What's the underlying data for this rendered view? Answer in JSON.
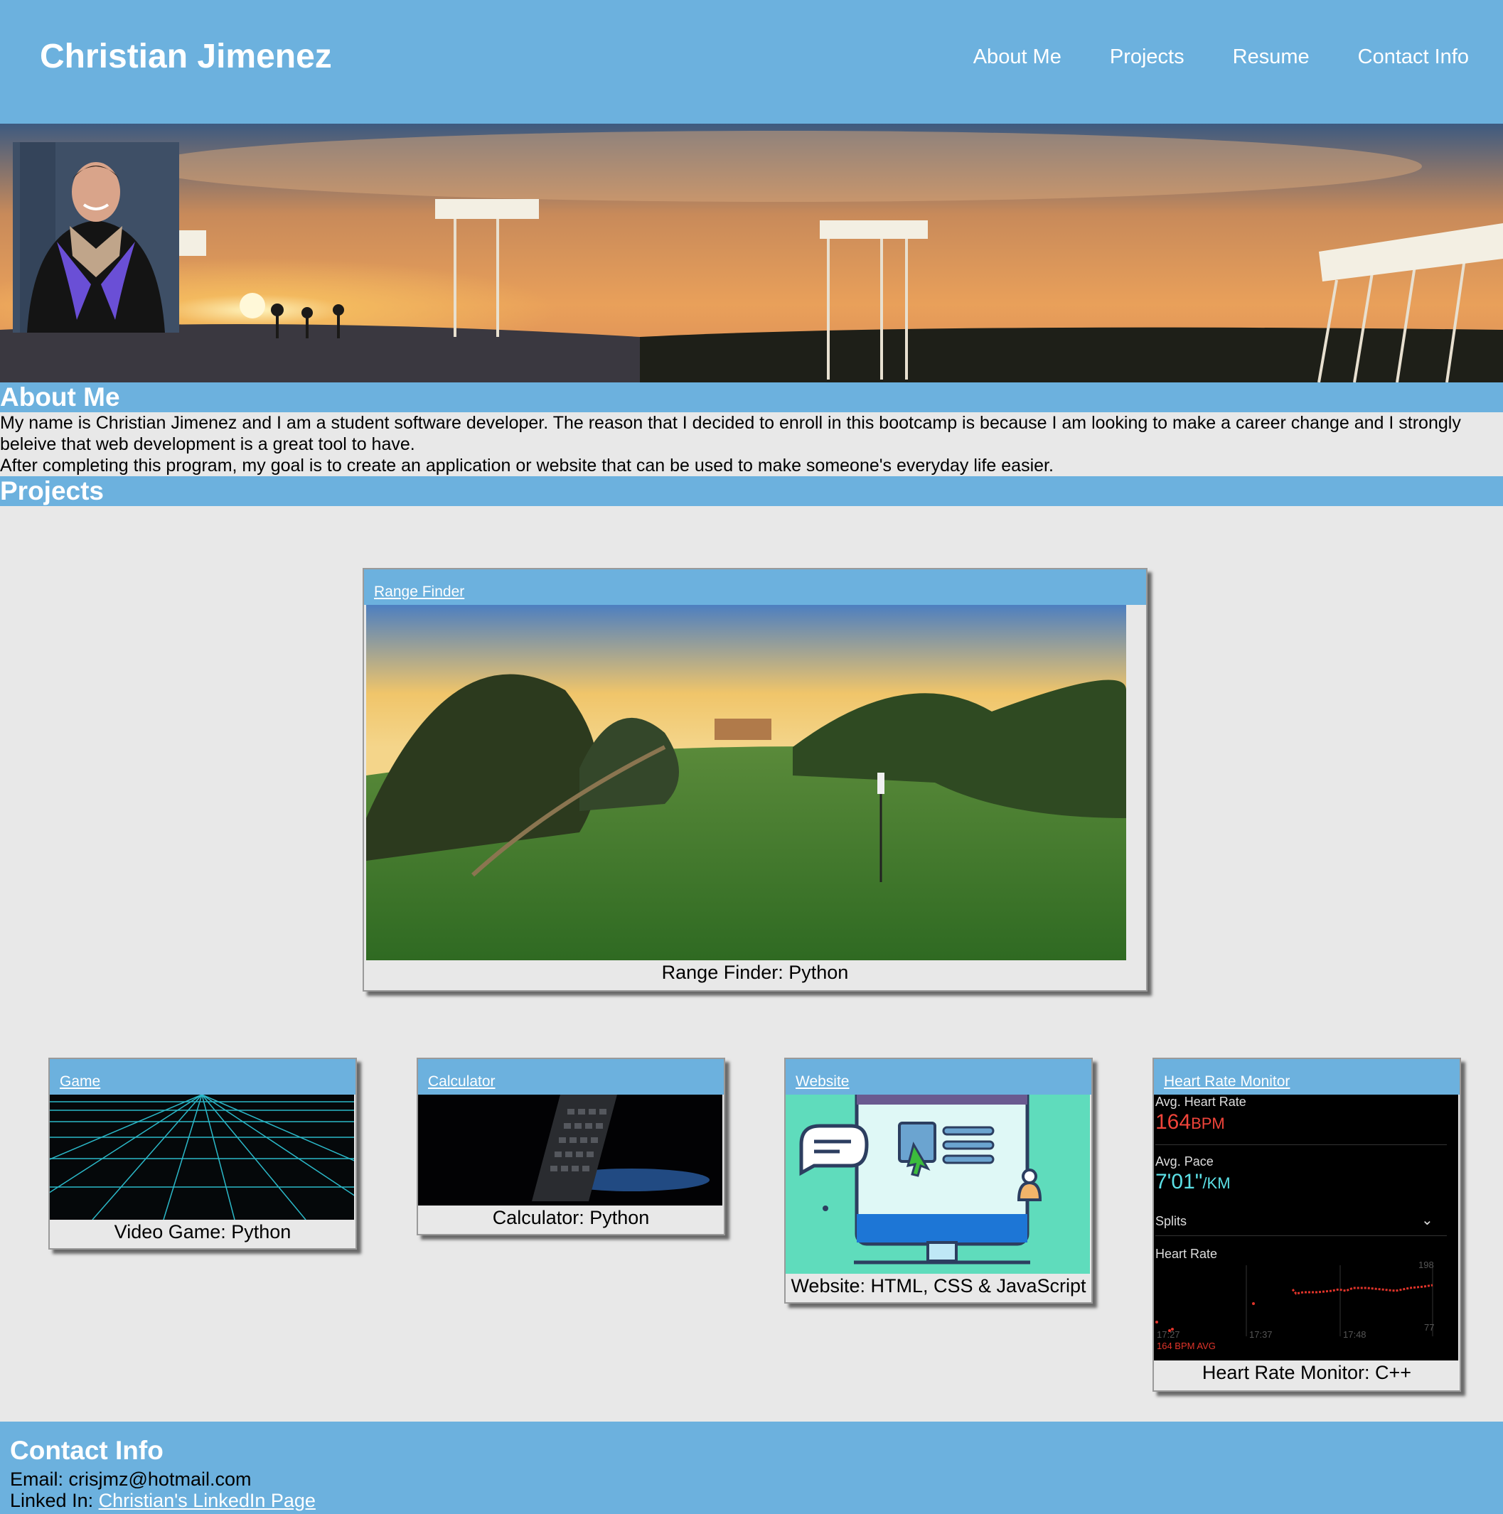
{
  "header": {
    "title": "Christian Jimenez",
    "nav": [
      "About Me",
      "Projects",
      "Resume",
      "Contact Info"
    ]
  },
  "about": {
    "heading": "About Me",
    "paragraph1": "My name is Christian Jimenez and I am a student software developer. The reason that I decided to enroll in this bootcamp is because I am looking to make a career change and I strongly beleive that web development is a great tool to have.",
    "paragraph2": "After completing this program, my goal is to create an application or website that can be used to make someone's everyday life easier."
  },
  "projects": {
    "heading": "Projects",
    "featured": {
      "link": "Range Finder",
      "caption": "Range Finder: Python"
    },
    "items": [
      {
        "link": "Game",
        "caption": "Video Game: Python"
      },
      {
        "link": "Calculator",
        "caption": "Calculator: Python"
      },
      {
        "link": "Website",
        "caption": "Website: HTML, CSS & JavaScript"
      },
      {
        "link": "Heart Rate Monitor",
        "caption": "Heart Rate Monitor: C++"
      }
    ]
  },
  "heart_rate_image": {
    "avg_hr_label": "Avg. Heart Rate",
    "avg_hr_value": "164",
    "avg_hr_unit": "BPM",
    "avg_pace_label": "Avg. Pace",
    "avg_pace_value": "7'01\"",
    "avg_pace_unit": "/KM",
    "splits_label": "Splits",
    "hr_label": "Heart Rate",
    "times": [
      "17:27",
      "17:37",
      "17:48"
    ],
    "max_label": "198",
    "min_label": "77",
    "avg_footer": "164 BPM AVG"
  },
  "contact": {
    "heading": "Contact Info",
    "email_label": "Email: ",
    "email": "crisjmz@hotmail.com",
    "linkedin_label": "Linked In: ",
    "linkedin_text": "Christian's LinkedIn Page"
  },
  "colors": {
    "accent": "#6cb1de",
    "background": "#e8e8e8"
  }
}
